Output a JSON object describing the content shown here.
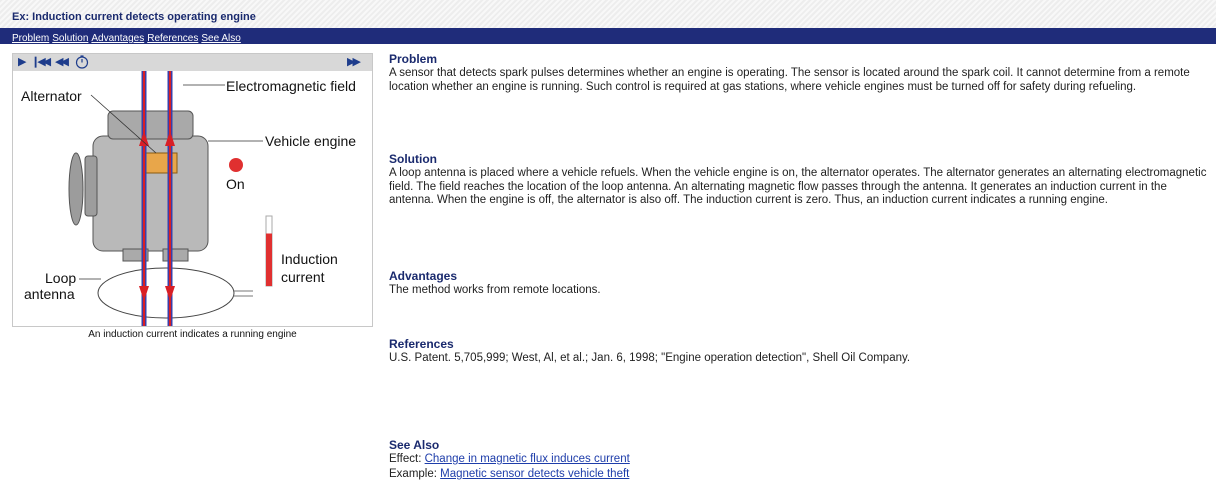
{
  "title": "Ex: Induction current detects operating engine",
  "nav": {
    "problem": "Problem",
    "solution": "Solution",
    "advantages": "Advantages",
    "references": "References",
    "see_also": "See Also"
  },
  "player": {
    "icons": [
      "play-icon",
      "skip-to-start-icon",
      "rewind-icon",
      "timer-icon",
      "fast-forward-icon"
    ]
  },
  "figure": {
    "alternator": "Alternator",
    "em_field": "Electromagnetic field",
    "vehicle_engine": "Vehicle engine",
    "on": "On",
    "induction_1": "Induction",
    "induction_2": "current",
    "loop_1": "Loop",
    "loop_2": "antenna",
    "caption": "An induction current indicates a running engine",
    "colors": {
      "field_red": "#d81f26",
      "field_blue": "#3a3fa8",
      "indicator_red": "#e03030"
    },
    "induction_level": 0.75
  },
  "sections": {
    "problem": {
      "heading": "Problem",
      "text": "A sensor that detects spark pulses determines whether an engine is operating.  The sensor is located around the spark coil.  It cannot determine from a remote location whether an engine is running.  Such control is required at gas stations, where vehicle engines must be turned off for safety during refueling."
    },
    "solution": {
      "heading": "Solution",
      "text": "A loop antenna is placed where a vehicle refuels.  When the vehicle engine is on, the alternator operates.  The alternator generates an alternating electromagnetic field.  The field reaches the location of the loop antenna.  An alternating magnetic flow passes through the antenna.  It generates an induction current in the antenna.  When the engine is off, the alternator is also off.  The induction current is zero.  Thus, an induction current indicates a running engine."
    },
    "advantages": {
      "heading": "Advantages",
      "text": "The method works from remote locations."
    },
    "references": {
      "heading": "References",
      "text": "U.S. Patent.  5,705,999; West, Al, et al.; Jan. 6, 1998; \"Engine operation detection\", Shell Oil Company."
    },
    "see_also": {
      "heading": "See Also",
      "effect_label": "Effect:",
      "effect_link": "Change in magnetic flux induces current",
      "example_label": "Example:",
      "example_link": "Magnetic sensor detects vehicle theft"
    }
  }
}
